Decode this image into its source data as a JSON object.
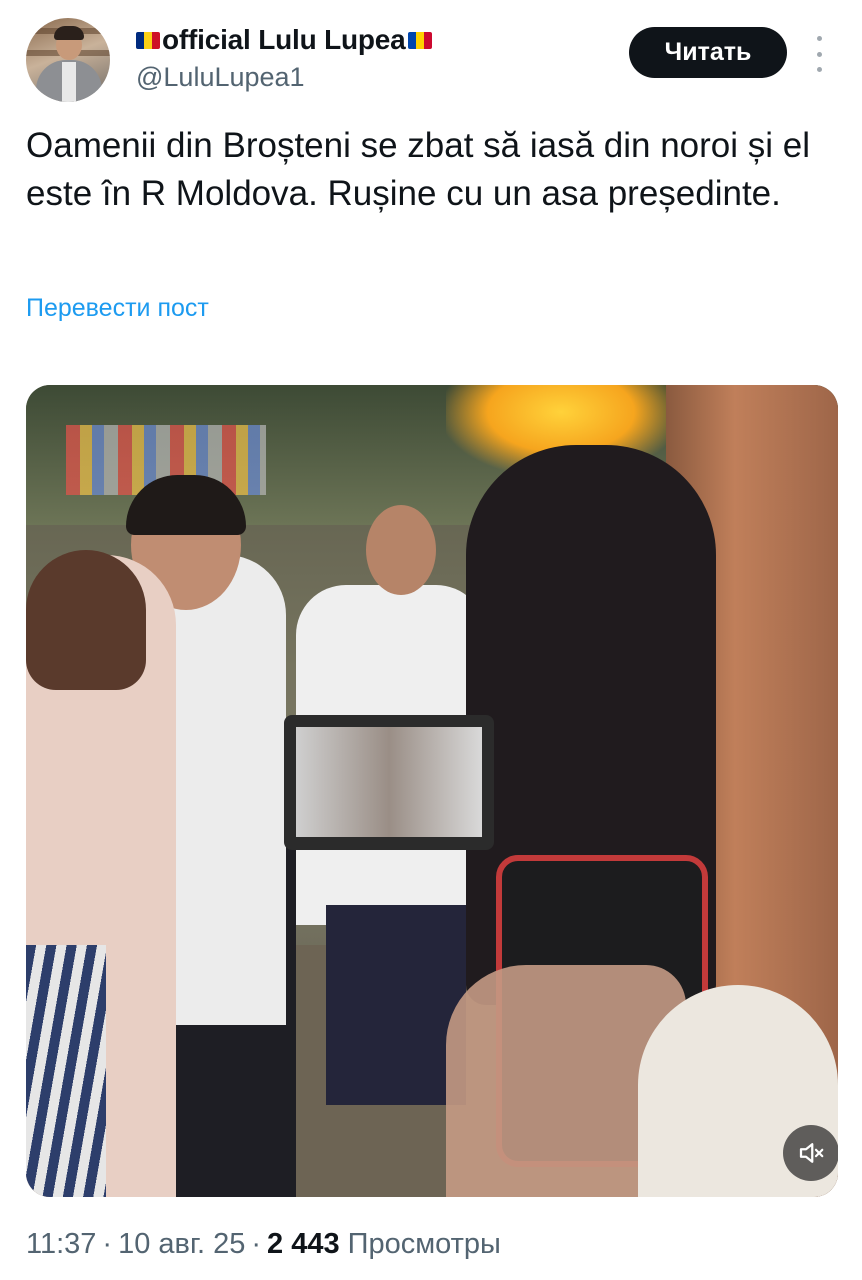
{
  "author": {
    "flag_left": "romania-flag-icon",
    "display_name": "official Lulu Lupea",
    "flag_right": "moldova-flag-icon",
    "handle": "@LuluLupea1"
  },
  "follow_button": {
    "label": "Читать"
  },
  "more_menu": {
    "icon": "more-vertical-icon"
  },
  "tweet": {
    "text": "Oamenii din Broșteni se zbat să iasă din noroi și el este în R Moldova. Rușine cu un asa președinte.",
    "translate_link": "Перевести пост"
  },
  "media": {
    "type": "video",
    "mute_icon": "volume-muted-icon"
  },
  "meta": {
    "time": "11:37",
    "date": "10 авг. 25",
    "separator": "·",
    "views_count": "2 443",
    "views_label": "Просмотры"
  },
  "colors": {
    "text_primary": "#0f1419",
    "text_secondary": "#536471",
    "link": "#1d9bf0",
    "button_bg": "#0f1419"
  }
}
